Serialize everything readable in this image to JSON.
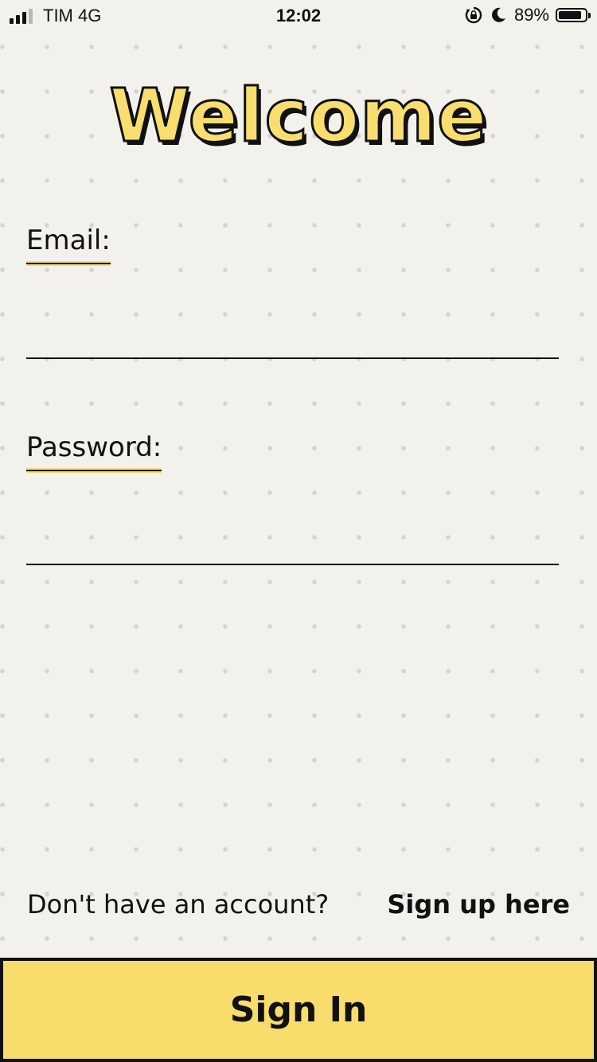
{
  "status_bar": {
    "carrier": "TIM 4G",
    "time": "12:02",
    "battery_percent": "89%",
    "battery_level": 0.89,
    "icons": [
      "signal-icon",
      "rotation-lock-icon",
      "moon-icon",
      "battery-icon"
    ]
  },
  "screen": {
    "title": "Welcome",
    "email_label": "Email:",
    "email_value": "",
    "password_label": "Password:",
    "password_value": ""
  },
  "footer": {
    "signup_prompt": "Don't have an account?",
    "signup_link": "Sign up here",
    "sign_in_label": "Sign In"
  },
  "colors": {
    "background": "#f2f1ec",
    "accent": "#f8dc6c",
    "ink": "#111111"
  }
}
